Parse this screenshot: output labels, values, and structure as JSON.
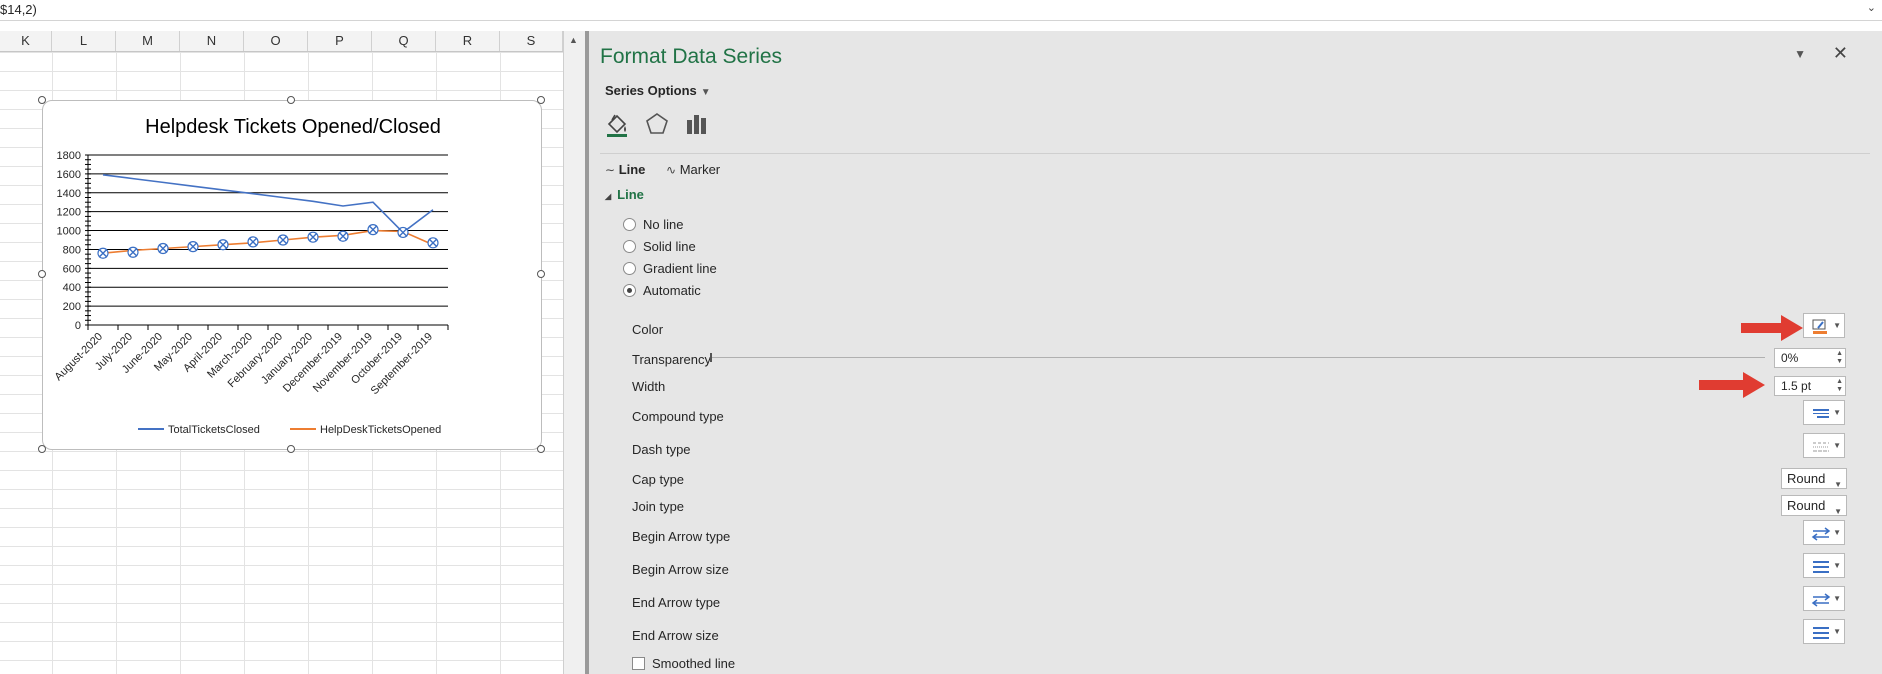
{
  "formula_bar": {
    "text": "$14,2)"
  },
  "sheet": {
    "columns": [
      "K",
      "L",
      "M",
      "N",
      "O",
      "P",
      "Q",
      "R",
      "S"
    ]
  },
  "chart_data": {
    "type": "line",
    "title": "Helpdesk Tickets Opened/Closed",
    "categories": [
      "August-2020",
      "July-2020",
      "June-2020",
      "May-2020",
      "April-2020",
      "March-2020",
      "February-2020",
      "January-2020",
      "December-2019",
      "November-2019",
      "October-2019",
      "September-2019"
    ],
    "series": [
      {
        "name": "TotalTicketsClosed",
        "color": "#4472c4",
        "values": [
          1590,
          1550,
          1510,
          1470,
          1430,
          1390,
          1350,
          1310,
          1260,
          1300,
          980,
          1220
        ]
      },
      {
        "name": "HelpDeskTicketsOpened",
        "color": "#ed7d31",
        "values": [
          760,
          790,
          810,
          830,
          850,
          870,
          900,
          930,
          950,
          1000,
          990,
          850
        ]
      }
    ],
    "marker_series": {
      "values": [
        760,
        770,
        810,
        830,
        850,
        880,
        900,
        930,
        940,
        1010,
        980,
        870
      ]
    },
    "y_ticks": [
      "0",
      "200",
      "400",
      "600",
      "800",
      "1000",
      "1200",
      "1400",
      "1600",
      "1800"
    ],
    "ylim": [
      0,
      1800
    ],
    "grid": true,
    "legend": "bottom"
  },
  "pane": {
    "title": "Format Data Series",
    "series_options_label": "Series Options",
    "tabs": {
      "line": "Line",
      "marker": "Marker"
    },
    "section": "Line",
    "radios": [
      {
        "label": "No line",
        "checked": false
      },
      {
        "label": "Solid line",
        "checked": false
      },
      {
        "label": "Gradient line",
        "checked": false
      },
      {
        "label": "Automatic",
        "checked": true
      }
    ],
    "labels": {
      "color": "Color",
      "transparency": "Transparency",
      "width": "Width",
      "compound": "Compound type",
      "dash": "Dash type",
      "cap": "Cap type",
      "join": "Join type",
      "begin_arrow_type": "Begin Arrow type",
      "begin_arrow_size": "Begin Arrow size",
      "end_arrow_type": "End Arrow type",
      "end_arrow_size": "End Arrow size",
      "smoothed": "Smoothed line"
    },
    "values": {
      "transparency": "0%",
      "width": "1.5 pt",
      "cap": "Round",
      "join": "Round"
    }
  },
  "colors": {
    "accent": "#217346",
    "arrow": "#e03c31"
  }
}
